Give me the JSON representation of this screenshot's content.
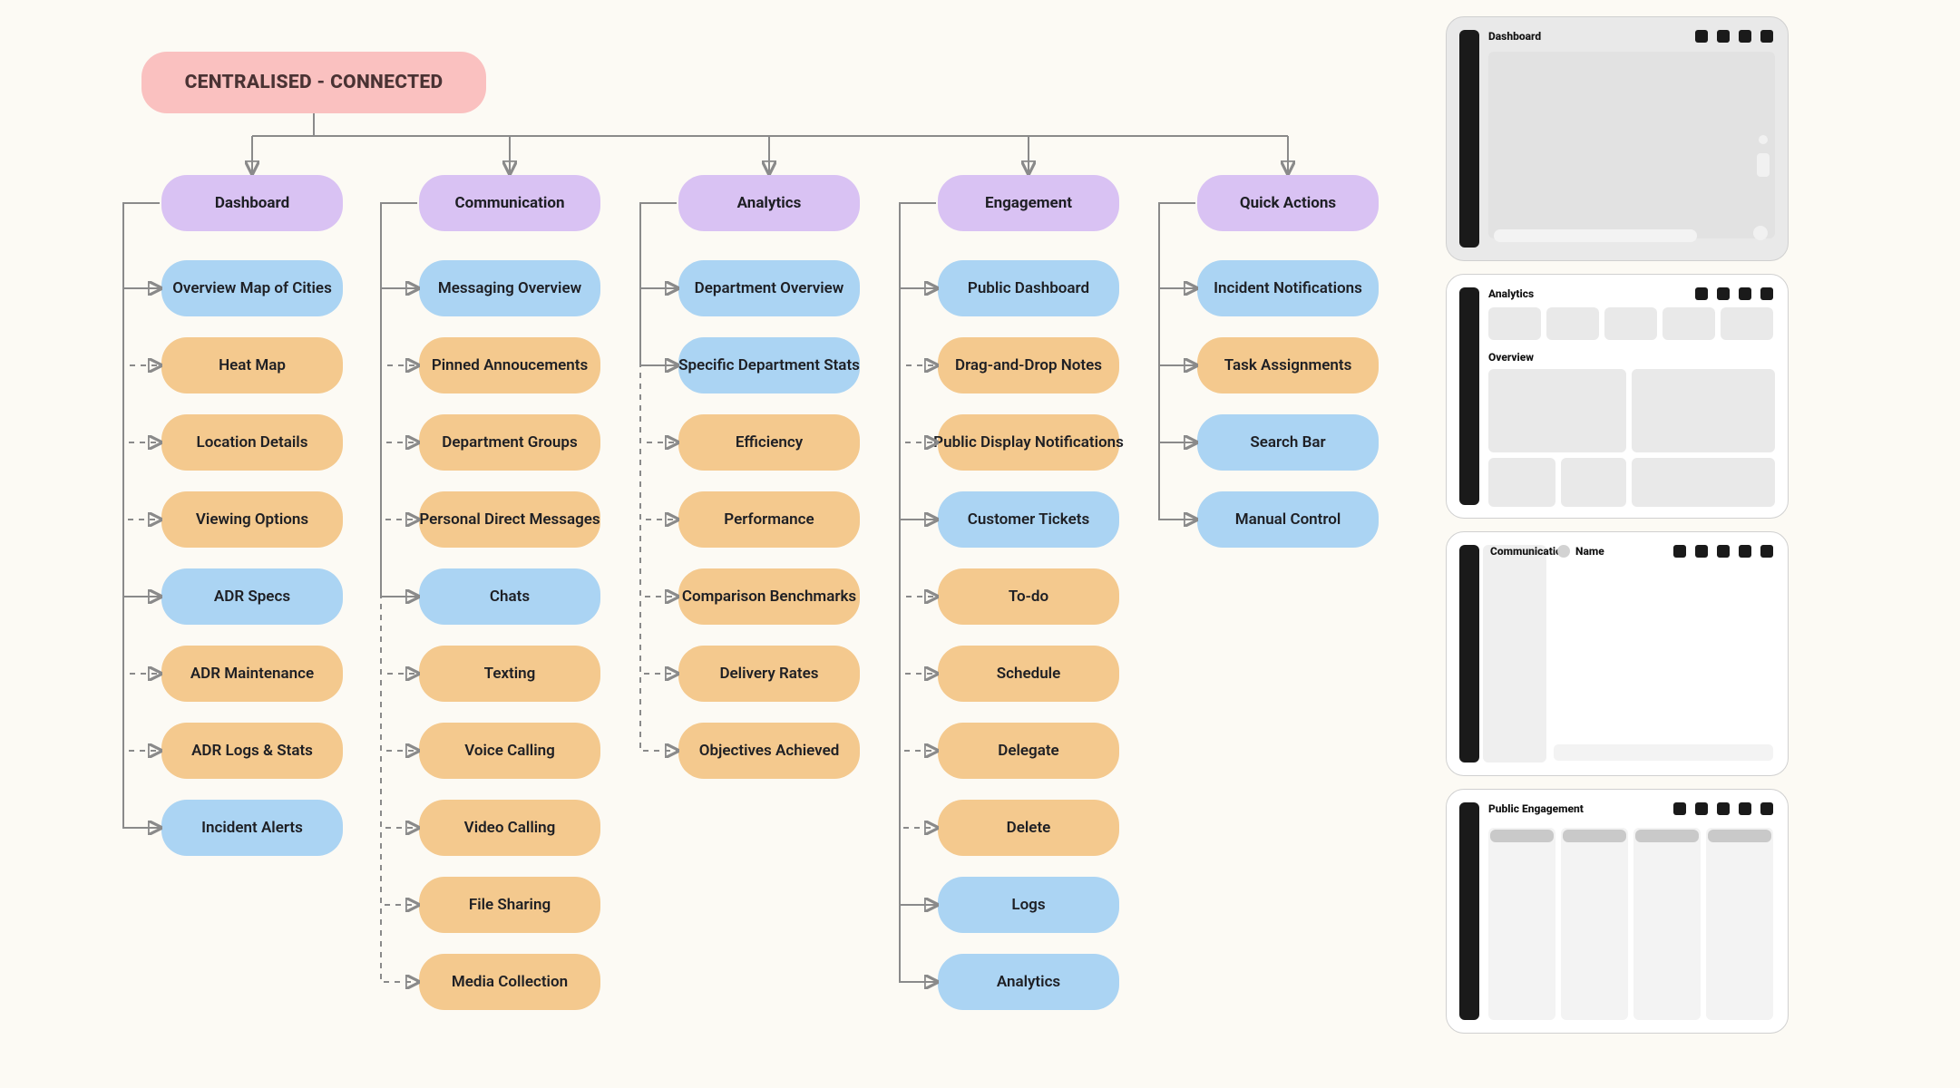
{
  "root": {
    "label": "CENTRALISED - CONNECTED"
  },
  "categories": [
    {
      "id": "dashboard",
      "label": "Dashboard"
    },
    {
      "id": "communication",
      "label": "Communication"
    },
    {
      "id": "analytics",
      "label": "Analytics"
    },
    {
      "id": "engagement",
      "label": "Engagement"
    },
    {
      "id": "quickactions",
      "label": "Quick Actions"
    }
  ],
  "tree": {
    "dashboard": [
      {
        "label": "Overview Map of Cities",
        "color": "blue"
      },
      {
        "label": "Heat Map",
        "color": "orange"
      },
      {
        "label": "Location Details",
        "color": "orange"
      },
      {
        "label": "Viewing Options",
        "color": "orange"
      },
      {
        "label": "ADR Specs",
        "color": "blue"
      },
      {
        "label": "ADR Maintenance",
        "color": "orange"
      },
      {
        "label": "ADR Logs & Stats",
        "color": "orange"
      },
      {
        "label": "Incident Alerts",
        "color": "blue"
      }
    ],
    "communication": [
      {
        "label": "Messaging Overview",
        "color": "blue"
      },
      {
        "label": "Pinned Annoucements",
        "color": "orange"
      },
      {
        "label": "Department Groups",
        "color": "orange"
      },
      {
        "label": "Personal Direct Messages",
        "color": "orange"
      },
      {
        "label": "Chats",
        "color": "blue"
      },
      {
        "label": "Texting",
        "color": "orange"
      },
      {
        "label": "Voice Calling",
        "color": "orange"
      },
      {
        "label": "Video Calling",
        "color": "orange"
      },
      {
        "label": "File Sharing",
        "color": "orange"
      },
      {
        "label": "Media Collection",
        "color": "orange"
      }
    ],
    "analytics": [
      {
        "label": "Department Overview",
        "color": "blue"
      },
      {
        "label": "Specific Department Stats",
        "color": "blue"
      },
      {
        "label": "Efficiency",
        "color": "orange"
      },
      {
        "label": "Performance",
        "color": "orange"
      },
      {
        "label": "Comparison Benchmarks",
        "color": "orange"
      },
      {
        "label": "Delivery Rates",
        "color": "orange"
      },
      {
        "label": "Objectives Achieved",
        "color": "orange"
      }
    ],
    "engagement": [
      {
        "label": "Public Dashboard",
        "color": "blue"
      },
      {
        "label": "Drag-and-Drop Notes",
        "color": "orange"
      },
      {
        "label": "Public Display Notifications",
        "color": "orange"
      },
      {
        "label": "Customer Tickets",
        "color": "blue"
      },
      {
        "label": "To-do",
        "color": "orange"
      },
      {
        "label": "Schedule",
        "color": "orange"
      },
      {
        "label": "Delegate",
        "color": "orange"
      },
      {
        "label": "Delete",
        "color": "orange"
      },
      {
        "label": "Logs",
        "color": "blue"
      },
      {
        "label": "Analytics",
        "color": "blue"
      }
    ],
    "quickactions": [
      {
        "label": "Incident Notifications",
        "color": "blue"
      },
      {
        "label": "Task Assignments",
        "color": "orange"
      },
      {
        "label": "Search Bar",
        "color": "blue"
      },
      {
        "label": "Manual Control",
        "color": "blue"
      }
    ]
  },
  "sub_connectors": {
    "dashboard": [
      {
        "from": 0,
        "to": [
          1,
          2,
          3
        ]
      },
      {
        "from": 4,
        "to": [
          5,
          6
        ]
      },
      {
        "from": "cat",
        "to": [
          0,
          4,
          7
        ]
      }
    ],
    "communication": [
      {
        "from": 0,
        "to": [
          1,
          2,
          3
        ]
      },
      {
        "from": 4,
        "to": [
          5,
          6,
          7,
          8,
          9
        ]
      },
      {
        "from": "cat",
        "to": [
          0,
          4
        ]
      }
    ],
    "analytics": [
      {
        "from": 1,
        "to": [
          2,
          3,
          4,
          5,
          6
        ]
      },
      {
        "from": "cat",
        "to": [
          0,
          1
        ]
      }
    ],
    "engagement": [
      {
        "from": 0,
        "to": [
          1,
          2
        ]
      },
      {
        "from": 3,
        "to": [
          4,
          5,
          6,
          7
        ]
      },
      {
        "from": "cat",
        "to": [
          0,
          3,
          8,
          9
        ]
      }
    ],
    "quickactions": [
      {
        "from": "cat",
        "to": [
          0,
          1,
          2,
          3
        ]
      }
    ]
  },
  "thumbnails": [
    {
      "id": "dash",
      "title": "Dashboard",
      "icons": 4
    },
    {
      "id": "anal",
      "title": "Analytics",
      "subtitle": "Overview",
      "icons": 4
    },
    {
      "id": "comm",
      "title": "Communication",
      "icons": 5,
      "name_label": "Name"
    },
    {
      "id": "pub",
      "title": "Public Engagement",
      "icons": 5
    }
  ]
}
